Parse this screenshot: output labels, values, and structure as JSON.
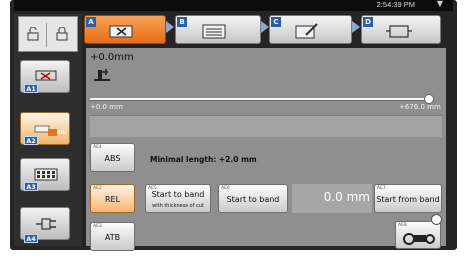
{
  "status_bar": {
    "clock": "2:54:39 PM",
    "menu_icon": "chevron-down-icon"
  },
  "lock_panel": {
    "icons": [
      "unlocked-padlock-icon",
      "locked-padlock-icon"
    ]
  },
  "side_buttons": [
    {
      "tag": "A1",
      "icon": "saw-cut-icon",
      "active": false
    },
    {
      "tag": "A2",
      "icon": "material-bar-icon",
      "active": true,
      "badge": "Alu"
    },
    {
      "tag": "A3",
      "icon": "keypad-icon",
      "active": false
    },
    {
      "tag": "A4",
      "icon": "connector-icon",
      "active": false
    }
  ],
  "tabs": [
    {
      "letter": "A",
      "icon": "saw-cut-icon",
      "active": true
    },
    {
      "letter": "B",
      "icon": "list-icon",
      "active": false
    },
    {
      "letter": "C",
      "icon": "edit-icon",
      "active": false
    },
    {
      "letter": "D",
      "icon": "cycle-icon",
      "active": false
    }
  ],
  "position": {
    "value": "+0.0mm",
    "range_min": "+0.0 mm",
    "range_max": "+676.0 mm",
    "slider_fraction": 1.0
  },
  "buttons": {
    "abs": {
      "tag": "AE4",
      "label": "ABS"
    },
    "rel": {
      "tag": "AE2",
      "label": "REL",
      "highlighted": true
    },
    "atb": {
      "tag": "AE3",
      "label": "ATB"
    },
    "start_band_thickness": {
      "tag": "AE5",
      "label": "Start to band",
      "sublabel": "with thickness of cut"
    },
    "start_band": {
      "tag": "AE6",
      "label": "Start to band"
    },
    "start_from_band": {
      "tag": "AE7",
      "label": "Start from band"
    },
    "corner": {
      "tag": "AE8",
      "icon": "saw-machine-icon"
    }
  },
  "minimal_length": "Minimal length: +2.0 mm",
  "distance_value": "0.0 mm",
  "colors": {
    "active_orange": "#e8721d",
    "tag_blue": "#2c5fa9",
    "panel_gray": "#8f8f8f",
    "screen_dark": "#242424"
  }
}
